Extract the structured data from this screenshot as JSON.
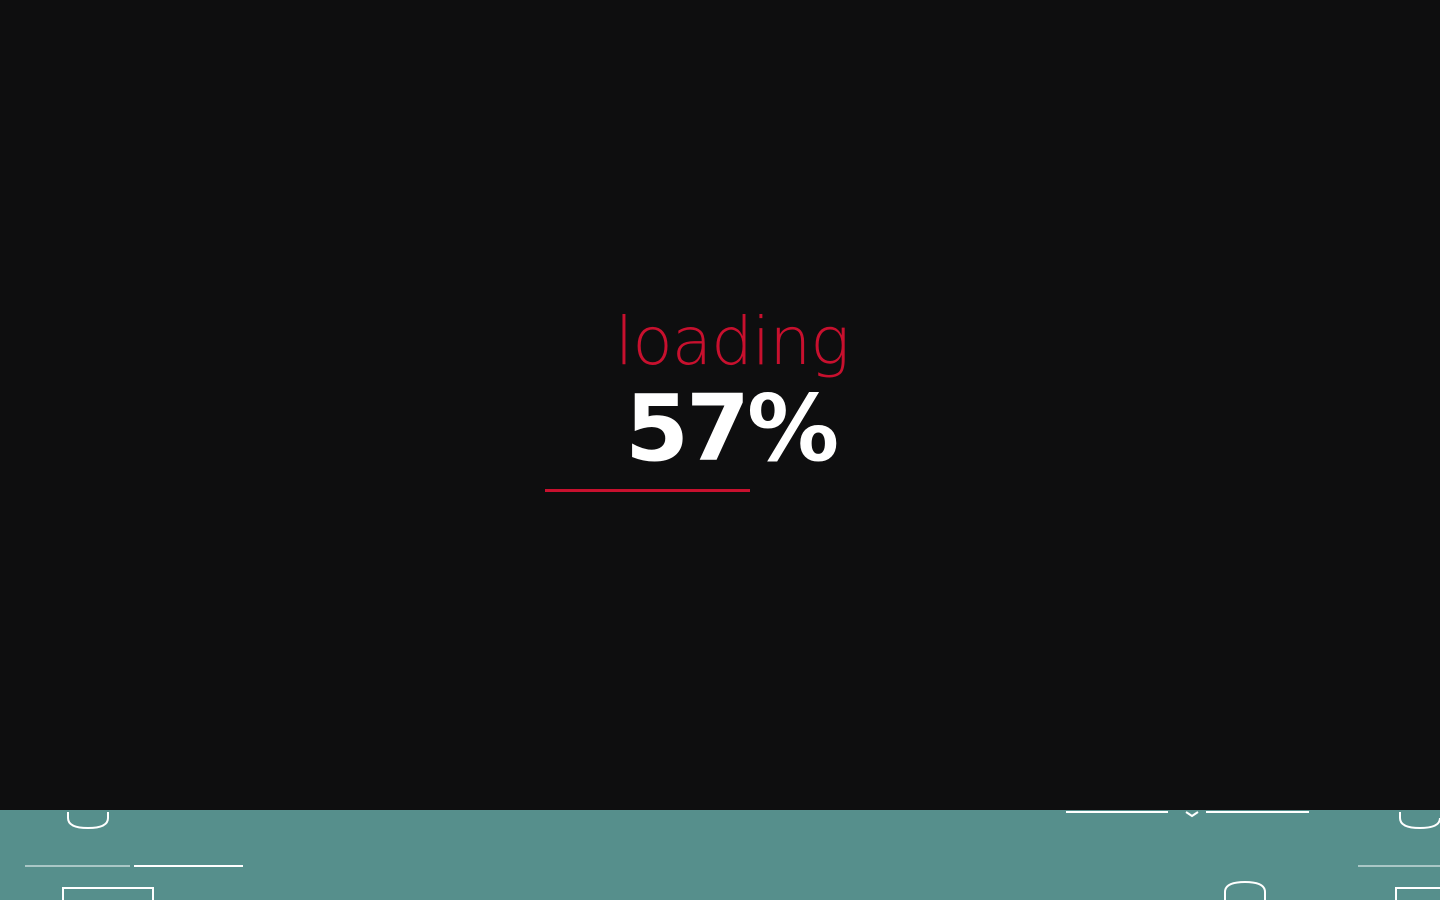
{
  "loader": {
    "label": "loading",
    "percent_text": "57%",
    "progress": 0.57
  },
  "colors": {
    "overlay_background": "#0e0e0f",
    "accent": "#c8102e",
    "percent_text": "#ffffff",
    "background_strip": "#568f8c",
    "background_lines": "#ffffff"
  }
}
